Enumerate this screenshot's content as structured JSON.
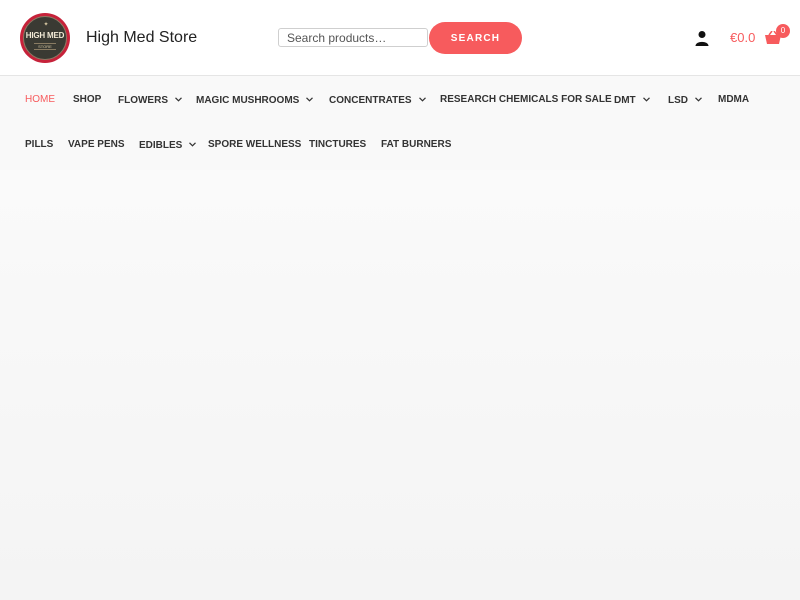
{
  "header": {
    "logo": {
      "text": "HIGH MED",
      "sub": "STORE",
      "leaf_icon": "leaf-icon"
    },
    "site_title": "High Med Store",
    "search": {
      "placeholder": "Search products…",
      "button_label": "SEARCH"
    },
    "account_icon": "user-icon",
    "cart": {
      "total": "€0.0",
      "count": "0",
      "icon": "basket-icon"
    },
    "colors": {
      "accent": "#f75b5d",
      "text": "#333333",
      "logo_ring": "#c6223a"
    }
  },
  "nav": {
    "items": [
      {
        "label": "HOME",
        "active": true
      },
      {
        "label": "SHOP"
      },
      {
        "label": "FLOWERS",
        "has_submenu": true
      },
      {
        "label": "MAGIC MUSHROOMS",
        "has_submenu": true
      },
      {
        "label": "CONCENTRATES",
        "has_submenu": true
      },
      {
        "label": "RESEARCH CHEMICALS FOR SALE"
      },
      {
        "label": "DMT",
        "has_submenu": true
      },
      {
        "label": "LSD",
        "has_submenu": true
      },
      {
        "label": "MDMA"
      },
      {
        "label": "PILLS"
      },
      {
        "label": "VAPE PENS"
      },
      {
        "label": "EDIBLES",
        "has_submenu": true
      },
      {
        "label": "SPORE WELLNESS"
      },
      {
        "label": "TINCTURES"
      },
      {
        "label": "FAT BURNERS"
      }
    ],
    "submenu_icon": "chevron-down-icon"
  }
}
